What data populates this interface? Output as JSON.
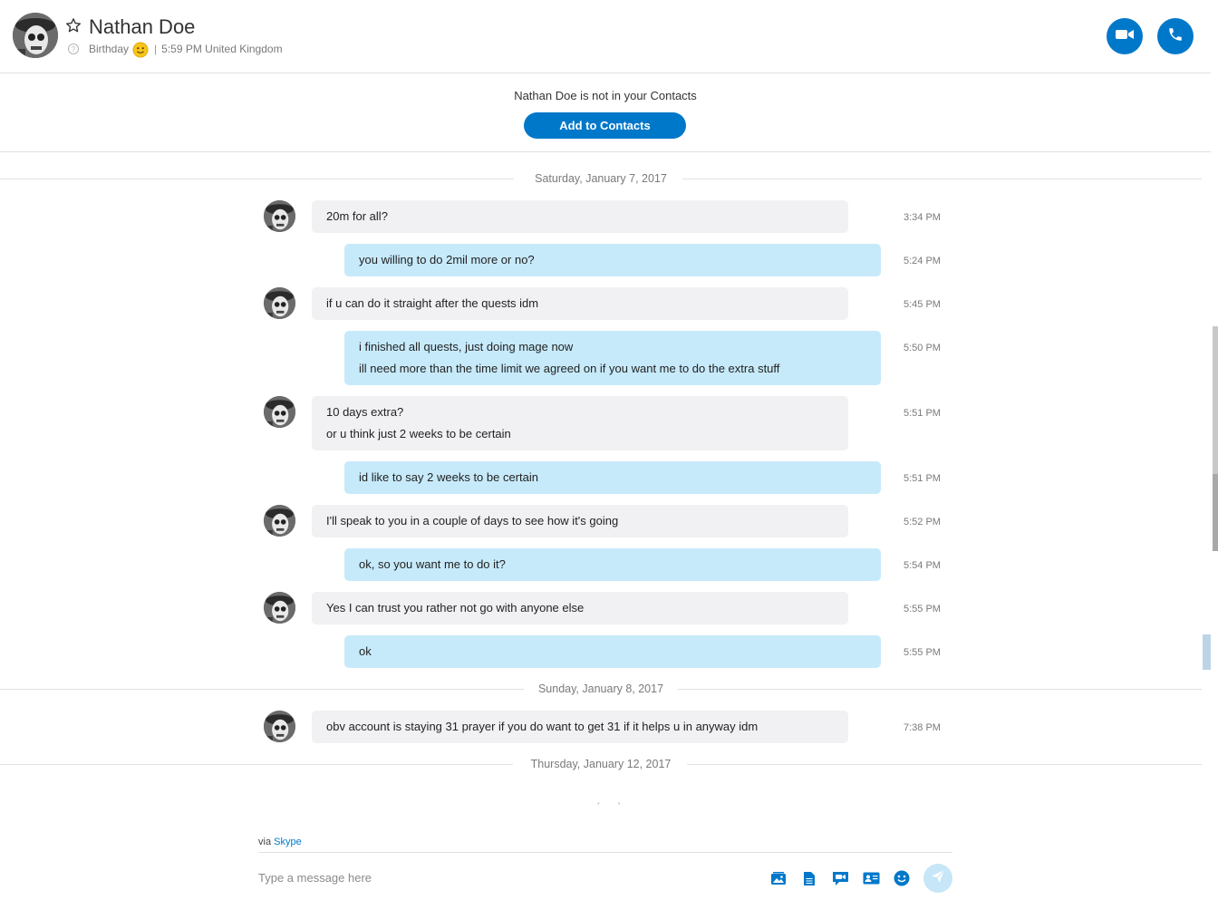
{
  "header": {
    "name": "Nathan Doe",
    "birthday_label": "Birthday",
    "separator": "|",
    "local_time": "5:59 PM United Kingdom",
    "icons": {
      "star": "star-icon",
      "help": "question-icon",
      "birthday": "smiley-icon",
      "video": "video-camera-icon",
      "call": "phone-icon"
    },
    "accent_color": "#0078ca"
  },
  "notice": {
    "text": "Nathan Doe is not in your Contacts",
    "button_label": "Add to Contacts"
  },
  "dates": {
    "d1": "Saturday, January 7, 2017",
    "d2": "Sunday, January 8, 2017",
    "d3": "Thursday, January 12, 2017"
  },
  "messages": [
    {
      "from": "contact",
      "lines": [
        "20m for all?"
      ],
      "time": "3:34 PM"
    },
    {
      "from": "me",
      "lines": [
        "you willing to do 2mil more or no?"
      ],
      "time": "5:24 PM"
    },
    {
      "from": "contact",
      "lines": [
        "if u can do it straight after the quests idm"
      ],
      "time": "5:45 PM"
    },
    {
      "from": "me",
      "lines": [
        "i finished all quests, just doing mage now",
        "ill need more than the time limit we agreed on if you want me to do the extra stuff"
      ],
      "time": "5:50 PM"
    },
    {
      "from": "contact",
      "lines": [
        "10 days extra?",
        "or u think just 2 weeks to be certain"
      ],
      "time": "5:51 PM"
    },
    {
      "from": "me",
      "lines": [
        "id like to say 2 weeks to be certain"
      ],
      "time": "5:51 PM"
    },
    {
      "from": "contact",
      "lines": [
        "I'll speak to you in a couple of days to see how it's going"
      ],
      "time": "5:52 PM"
    },
    {
      "from": "me",
      "lines": [
        "ok, so you want me to do it?"
      ],
      "time": "5:54 PM"
    },
    {
      "from": "contact",
      "lines": [
        "Yes I can trust you rather not go with anyone else"
      ],
      "time": "5:55 PM"
    },
    {
      "from": "me",
      "lines": [
        "ok"
      ],
      "time": "5:55 PM"
    },
    {
      "from": "contact",
      "lines": [
        "obv account is staying 31 prayer if you do want to get 31 if it helps u in anyway idm"
      ],
      "time": "7:38 PM"
    }
  ],
  "composer": {
    "via_prefix": "via",
    "via_link": "Skype",
    "placeholder": "Type a message here",
    "tools": [
      "media-gallery-icon",
      "file-icon",
      "video-message-icon",
      "contact-card-icon",
      "emoticon-icon"
    ],
    "send": "send-icon"
  },
  "colors": {
    "incoming_bubble": "#f1f1f4",
    "outgoing_bubble": "#c7eafb"
  }
}
